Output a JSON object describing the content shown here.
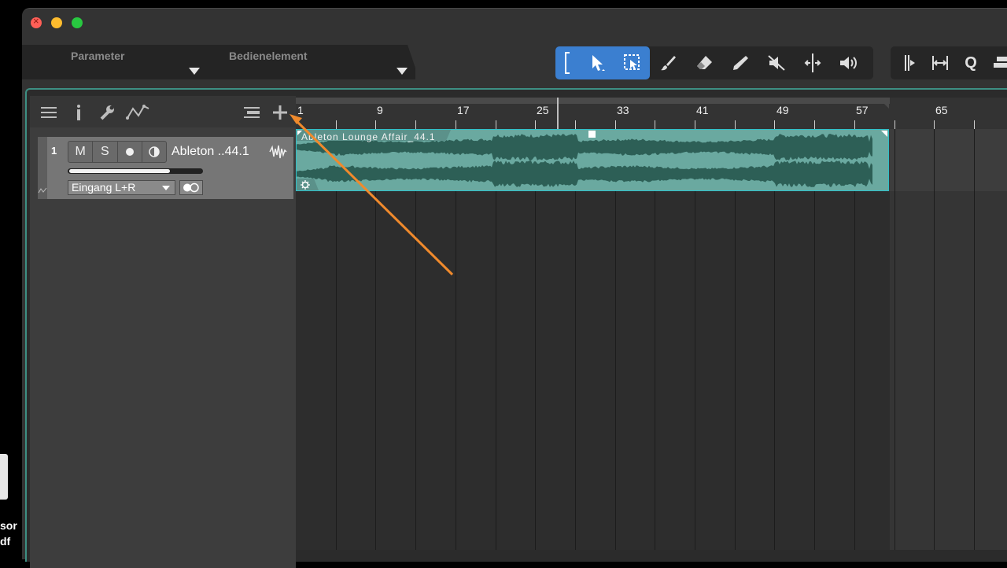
{
  "parameters": {
    "parameter_label": "Parameter",
    "control_label": "Bedienelement"
  },
  "toolbar": {
    "tools": [
      {
        "name": "range-bracket-icon",
        "active": true
      },
      {
        "name": "arrow-tool-icon",
        "active": true
      },
      {
        "name": "range-select-icon",
        "active": true
      },
      {
        "name": "paint-brush-icon",
        "active": false
      },
      {
        "name": "eraser-icon",
        "active": false
      },
      {
        "name": "pencil-icon",
        "active": false
      },
      {
        "name": "mute-tool-icon",
        "active": false
      },
      {
        "name": "split-tool-icon",
        "active": false
      },
      {
        "name": "listen-tool-icon",
        "active": false
      }
    ],
    "right_tools": [
      "snap-icon",
      "bend-icon",
      "quantize-icon",
      "more-icon"
    ],
    "quantize_label": "Q"
  },
  "track": {
    "number": "1",
    "mute_label": "M",
    "solo_label": "S",
    "name": "Ableton ..44.1",
    "input": "Eingang L+R",
    "volume_level": 0.76
  },
  "ruler": {
    "labels": [
      "1",
      "9",
      "17",
      "25",
      "33",
      "41",
      "49",
      "57",
      "65"
    ]
  },
  "clip": {
    "title": "Ableton Lounge Affair_44.1"
  },
  "desktop": {
    "label_1": "sor",
    "label_2": "df"
  },
  "colors": {
    "accent": "#3b7fd0",
    "clip": "#6aa9a0",
    "annotation_arrow": "#f08a2c"
  }
}
